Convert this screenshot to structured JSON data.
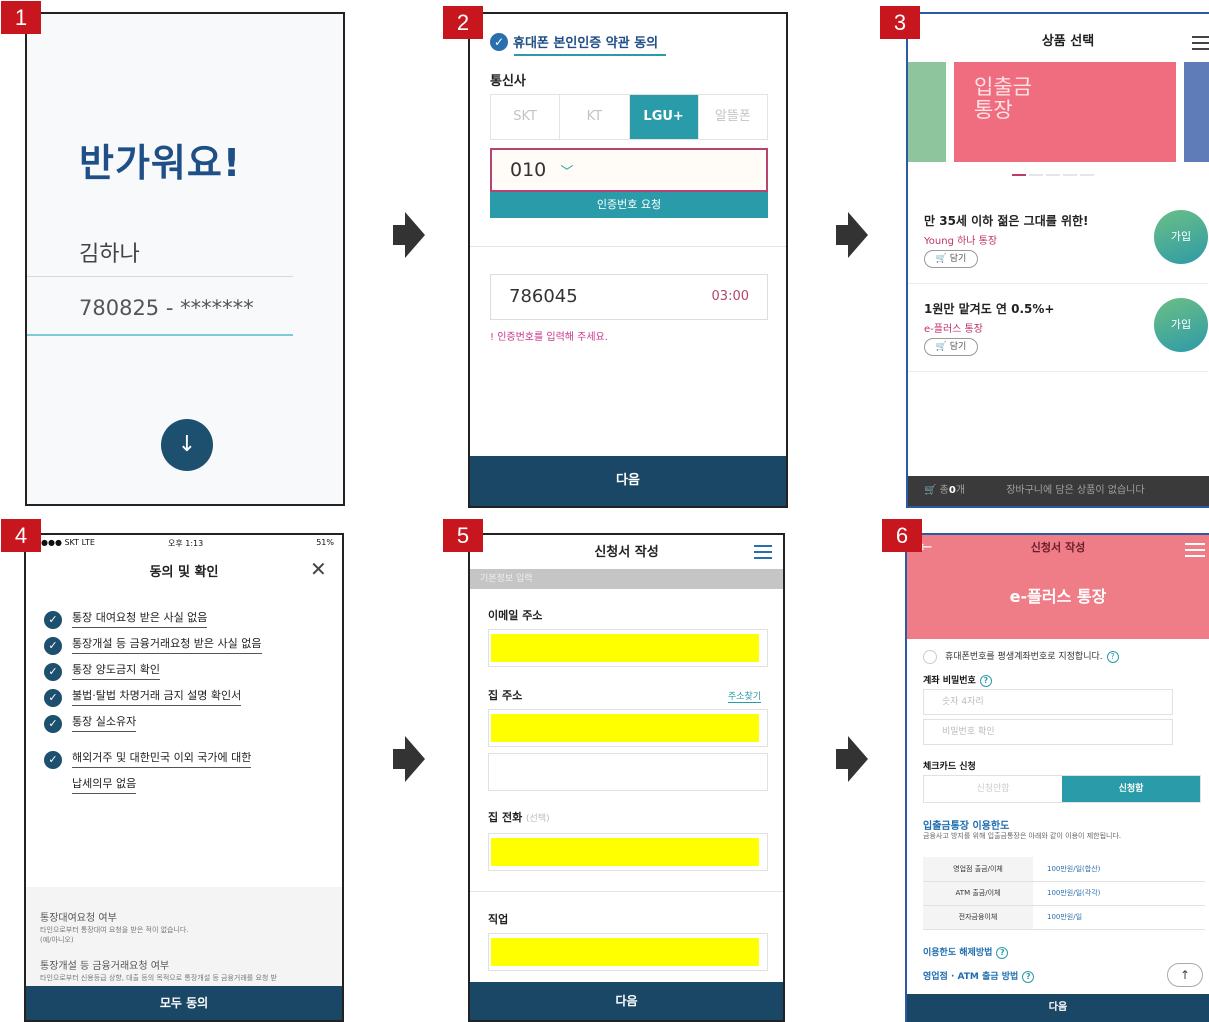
{
  "steps": [
    "1",
    "2",
    "3",
    "4",
    "5",
    "6"
  ],
  "p1": {
    "welcome": "반가워요!",
    "name": "김하나",
    "ssn": "780825 - *******",
    "next_icon": "↓"
  },
  "p2": {
    "header": "휴대폰 본인인증 약관 동의",
    "carrier_label": "통신사",
    "carriers": [
      "SKT",
      "KT",
      "LGU+",
      "알뜰폰"
    ],
    "selected_carrier": "LGU+",
    "prefix": "010",
    "request_btn": "인증번호 요청",
    "code": "786045",
    "timer": "03:00",
    "hint": "! 인증번호를 입력해 주세요.",
    "next": "다음"
  },
  "p3": {
    "title": "상품 선택",
    "card_title": "입출금\n통장",
    "products": [
      {
        "headline": "만 35세 이하 젊은 그대를 위한!",
        "name": "Young 하나 통장",
        "cart": "담기",
        "join": "가입"
      },
      {
        "headline": "1원만 맡겨도 연 0.5%+",
        "name": "e-플러스 통장",
        "cart": "담기",
        "join": "가입"
      }
    ],
    "cart_count": "0",
    "cart_prefix": "총",
    "cart_unit": "개",
    "cart_msg": "장바구니에 담은 상품이 없습니다"
  },
  "p4": {
    "status_left": "●●●● SKT  LTE",
    "status_center": "오후 1:13",
    "status_right": "51%",
    "title": "동의 및 확인",
    "items": [
      "통장 대여요청 받은 사실 없음",
      "통장개설 등 금융거래요청 받은 사실 없음",
      "통장 양도금지 확인",
      "불법·탈법 차명거래 금지 설명 확인서",
      "통장 실소유자",
      "해외거주 및 대한민국 이외 국가에 대한",
      "납세의무 없음"
    ],
    "detail1_title": "통장대여요청 여부",
    "detail1_text": "타인으로부터 통장대여 요청을 받은 적이 없습니다.",
    "detail1_opts": "(예/아니오)",
    "detail2_title": "통장개설 등 금융거래요청 여부",
    "detail2_text": "타인으로부터 신용등급 상향, 대출 등의 목적으로 통장개설 등 금융거래를 요청 받",
    "agree_all": "모두 동의"
  },
  "p5": {
    "title": "신청서 작성",
    "section": "기본정보 입력",
    "email": "이메일 주소",
    "address": "집 주소",
    "find_addr": "주소찾기",
    "phone": "집 전화",
    "phone_opt": "(선택)",
    "job": "직업",
    "next": "다음"
  },
  "p6": {
    "title": "신청서 작성",
    "product": "e-플러스 통장",
    "lifetime": "휴대폰번호를 평생계좌번호로 지정합니다.",
    "pw_label": "계좌 비밀번호",
    "pw_ph": "숫자 4자리",
    "pw_confirm_ph": "비밀번호 확인",
    "card_label": "체크카드 신청",
    "card_no": "신청안함",
    "card_yes": "신청함",
    "limit_title": "입출금통장 이용한도",
    "limit_desc": "금융사고 방지를 위해 입출금통장은 아래와 같이 이용이 제한됩니다.",
    "limits": [
      {
        "k": "영업점 출금/이체",
        "v": "100만원/일(합산)"
      },
      {
        "k": "ATM 출금/이체",
        "v": "100만원/일(각각)"
      },
      {
        "k": "전자금융이체",
        "v": "100만원/일"
      }
    ],
    "release": "이용한도 해제방법",
    "atm_method": "영업점 · ATM 출금 방법",
    "next": "다음"
  }
}
